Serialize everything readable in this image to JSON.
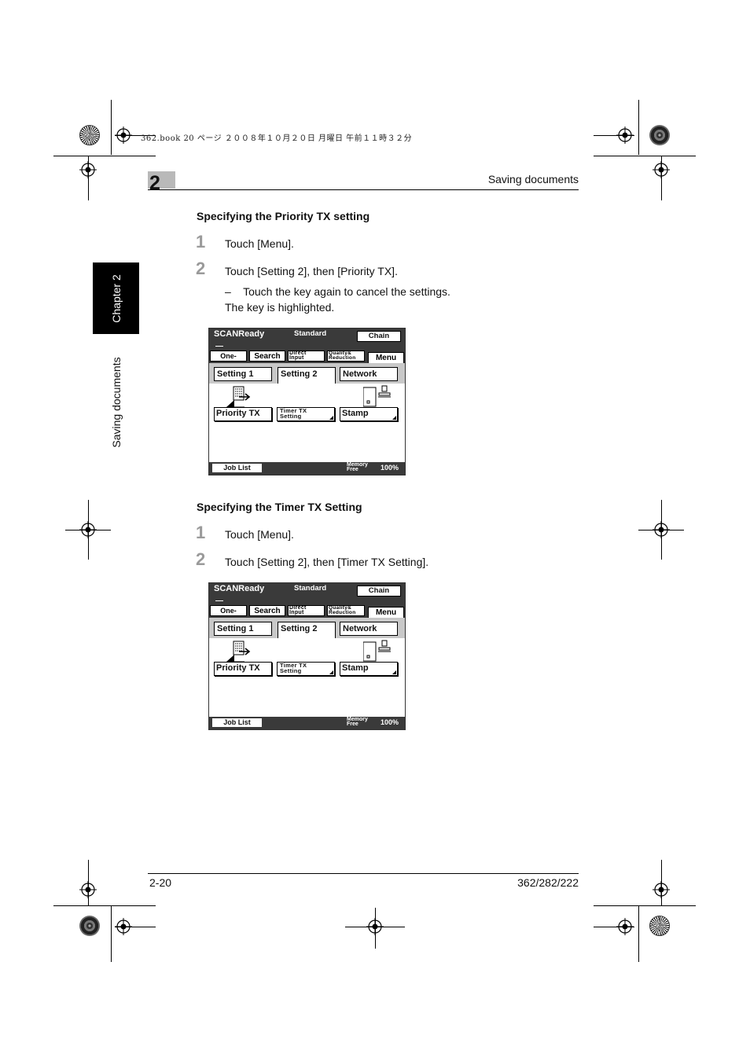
{
  "print_note": "362.book  20 ページ  ２００８年１０月２０日  月曜日  午前１１時３２分",
  "header": {
    "chapter_number": "2",
    "title": "Saving documents"
  },
  "side": {
    "tab_label": "Chapter 2",
    "section_label": "Saving documents"
  },
  "sections": [
    {
      "heading": "Specifying the Priority TX setting",
      "steps": [
        {
          "number": "1",
          "text": "Touch [Menu]."
        },
        {
          "number": "2",
          "text": "Touch [Setting 2], then [Priority TX]."
        }
      ],
      "note": "–    Touch the key again to cancel the settings.",
      "note2": "The key is highlighted."
    },
    {
      "heading": "Specifying the Timer TX Setting",
      "steps": [
        {
          "number": "1",
          "text": "Touch [Menu]."
        },
        {
          "number": "2",
          "text": "Touch [Setting 2], then [Timer TX Setting]."
        }
      ]
    }
  ],
  "panel": {
    "status": "SCANReady",
    "mode": "Standard",
    "chain": "Chain",
    "tabs": {
      "one_touch": "One-Touch",
      "search": "Search",
      "direct_1": "Direct",
      "direct_2": "Input",
      "quality_1": "Quality&",
      "quality_2": "Reduction",
      "menu": "Menu"
    },
    "subtabs": {
      "setting1": "Setting 1",
      "setting2": "Setting 2",
      "network": "Network"
    },
    "keys": {
      "priority": "Priority TX",
      "timer_1": "Timer TX",
      "timer_2": "Setting",
      "stamp": "Stamp"
    },
    "footer": {
      "job_list": "Job List",
      "memory_1": "Memory",
      "memory_2": "Free",
      "memory_value": "100%"
    }
  },
  "footer": {
    "page": "2-20",
    "model": "362/282/222"
  }
}
